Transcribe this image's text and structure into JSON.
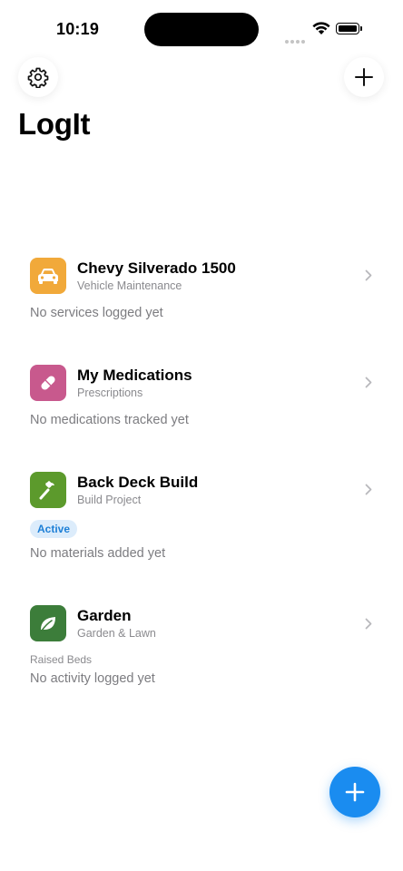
{
  "status_bar": {
    "time": "10:19"
  },
  "header": {
    "title": "LogIt"
  },
  "items": [
    {
      "title": "Chevy Silverado 1500",
      "subtitle": "Vehicle Maintenance",
      "note": "No services logged yet",
      "icon": "car-icon",
      "color": "#f1a93a"
    },
    {
      "title": "My Medications",
      "subtitle": "Prescriptions",
      "note": "No medications tracked yet",
      "icon": "pill-icon",
      "color": "#c8598d"
    },
    {
      "title": "Back Deck Build",
      "subtitle": "Build Project",
      "badge": "Active",
      "note": "No materials added yet",
      "icon": "hammer-icon",
      "color": "#5c9a2c"
    },
    {
      "title": "Garden",
      "subtitle": "Garden & Lawn",
      "label": "Raised Beds",
      "note": "No activity logged yet",
      "icon": "leaf-icon",
      "color": "#3c7d3a"
    }
  ],
  "colors": {
    "accent": "#1a8cf0"
  }
}
